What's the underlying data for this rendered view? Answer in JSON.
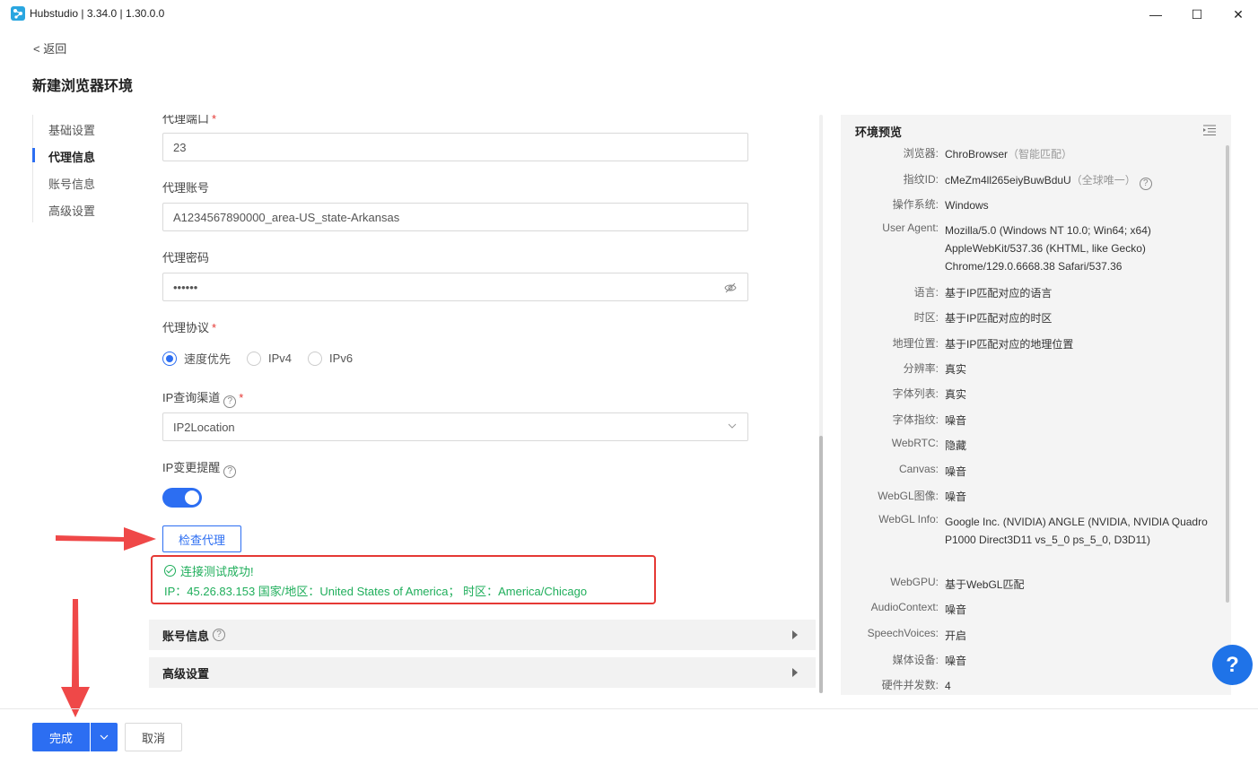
{
  "window": {
    "title": "Hubstudio | 3.34.0 | 1.30.0.0",
    "minimize": "—",
    "maximize": "☐",
    "close": "✕"
  },
  "header": {
    "back": "< 返回",
    "page_title": "新建浏览器环境"
  },
  "sidebar": {
    "items": [
      {
        "label": "基础设置"
      },
      {
        "label": "代理信息",
        "active": true
      },
      {
        "label": "账号信息"
      },
      {
        "label": "高级设置"
      }
    ]
  },
  "form": {
    "proxy_port": {
      "label": "代理端口",
      "value": "23"
    },
    "proxy_account": {
      "label": "代理账号",
      "value": "A1234567890000_area-US_state-Arkansas"
    },
    "proxy_password": {
      "label": "代理密码",
      "value": "••••••"
    },
    "protocol": {
      "label": "代理协议",
      "options": [
        {
          "label": "速度优先",
          "selected": true
        },
        {
          "label": "IPv4",
          "selected": false
        },
        {
          "label": "IPv6",
          "selected": false
        }
      ]
    },
    "ip_channel": {
      "label": "IP查询渠道",
      "value": "IP2Location"
    },
    "ip_change_alert": {
      "label": "IP变更提醒",
      "enabled": true
    },
    "check_button": "检查代理",
    "result": {
      "status": "连接测试成功!",
      "detail": "IP：45.26.83.153 国家/地区：United States of America； 时区：America/Chicago"
    },
    "sections": [
      {
        "title": "账号信息"
      },
      {
        "title": "高级设置"
      }
    ]
  },
  "preview": {
    "title": "环境预览",
    "rows": [
      {
        "key": "浏览器:",
        "value": "ChroBrowser",
        "hint": "（智能匹配）"
      },
      {
        "key": "指纹ID:",
        "value": "cMeZm4ll265eiyBuwBduU",
        "hint": "（全球唯一）"
      },
      {
        "key": "操作系统:",
        "value": "Windows"
      },
      {
        "key": "User Agent:",
        "value": "Mozilla/5.0 (Windows NT 10.0; Win64; x64) AppleWebKit/537.36 (KHTML, like Gecko) Chrome/129.0.6668.38 Safari/537.36"
      },
      {
        "key": "语言:",
        "value": "基于IP匹配对应的语言"
      },
      {
        "key": "时区:",
        "value": "基于IP匹配对应的时区"
      },
      {
        "key": "地理位置:",
        "value": "基于IP匹配对应的地理位置"
      },
      {
        "key": "分辨率:",
        "value": "真实"
      },
      {
        "key": "字体列表:",
        "value": "真实"
      },
      {
        "key": "字体指纹:",
        "value": "噪音"
      },
      {
        "key": "WebRTC:",
        "value": "隐藏"
      },
      {
        "key": "Canvas:",
        "value": "噪音"
      },
      {
        "key": "WebGL图像:",
        "value": "噪音"
      },
      {
        "key": "WebGL Info:",
        "value": "Google Inc. (NVIDIA) ANGLE (NVIDIA, NVIDIA Quadro P1000 Direct3D11 vs_5_0 ps_5_0, D3D11)"
      },
      {
        "key": "WebGPU:",
        "value": "基于WebGL匹配"
      },
      {
        "key": "AudioContext:",
        "value": "噪音"
      },
      {
        "key": "SpeechVoices:",
        "value": "开启"
      },
      {
        "key": "媒体设备:",
        "value": "噪音"
      },
      {
        "key": "硬件并发数:",
        "value": "4"
      }
    ]
  },
  "help_fab": "?",
  "footer": {
    "done": "完成",
    "cancel": "取消"
  },
  "colors": {
    "primary": "#2c6ef2",
    "success": "#1fae5b",
    "annotation": "#e53935"
  }
}
